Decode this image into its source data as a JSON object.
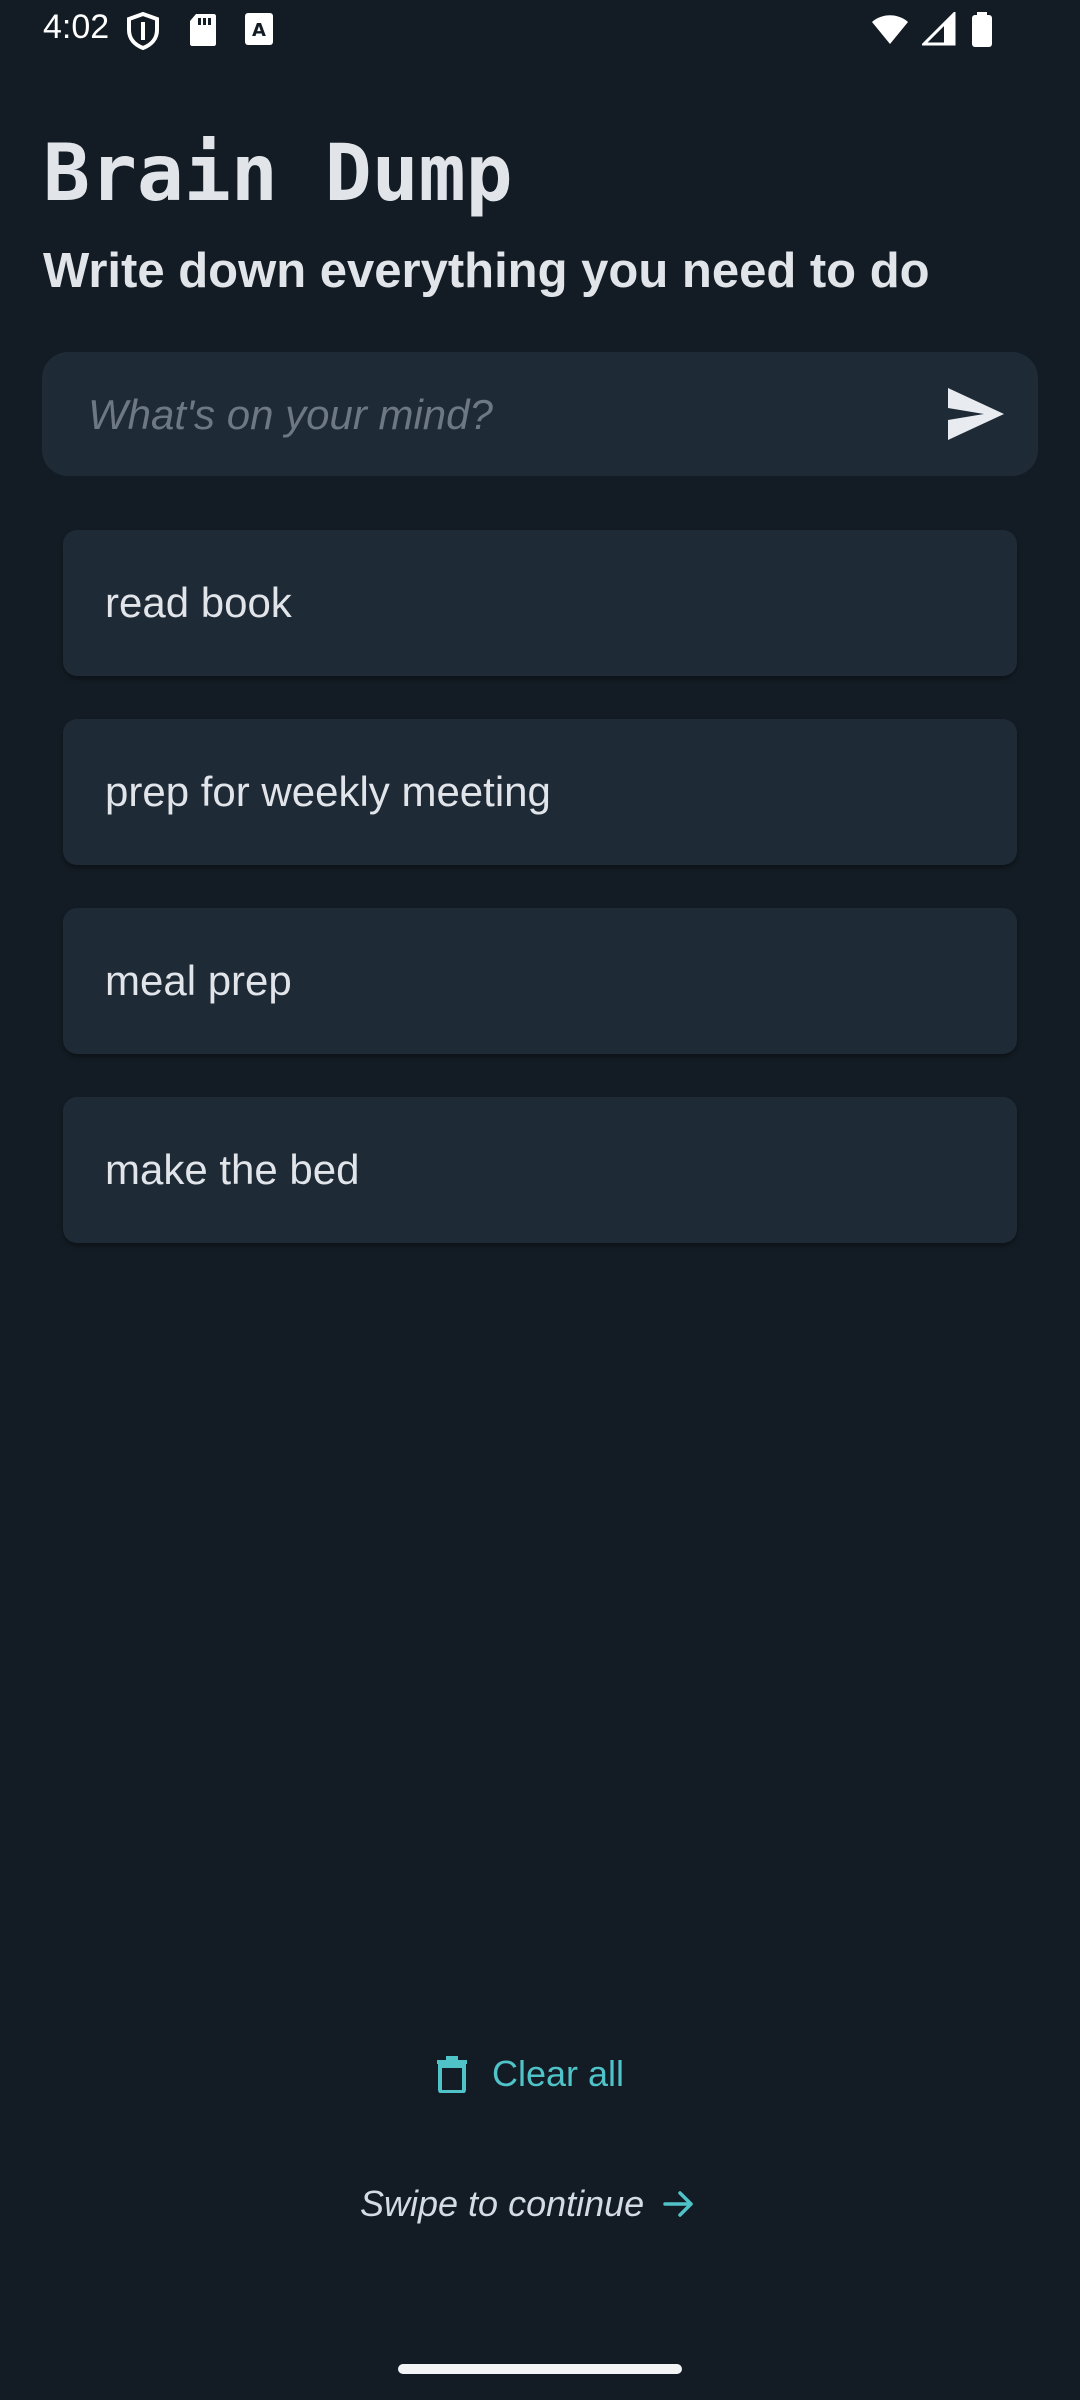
{
  "status_bar": {
    "time": "4:02",
    "left_icons": [
      "shield-icon",
      "sd-card-icon",
      "keyboard-a-icon"
    ],
    "right_icons": [
      "wifi-icon",
      "cell-signal-icon",
      "battery-icon"
    ]
  },
  "header": {
    "title": "Brain Dump",
    "subtitle": "Write down everything you need to do"
  },
  "input": {
    "value": "",
    "placeholder": "What's on your mind?",
    "send_icon": "send-icon"
  },
  "tasks": [
    {
      "label": "read book"
    },
    {
      "label": "prep for weekly meeting"
    },
    {
      "label": "meal prep"
    },
    {
      "label": "make the bed"
    }
  ],
  "footer": {
    "clear_all_label": "Clear all",
    "clear_all_icon": "trash-icon",
    "swipe_label": "Swipe to continue",
    "swipe_icon": "arrow-right-icon"
  },
  "colors": {
    "background": "#131c24",
    "card": "#1f2a37",
    "text": "#e1e5ea",
    "accent": "#4fc3c8",
    "placeholder": "#6e7885"
  }
}
